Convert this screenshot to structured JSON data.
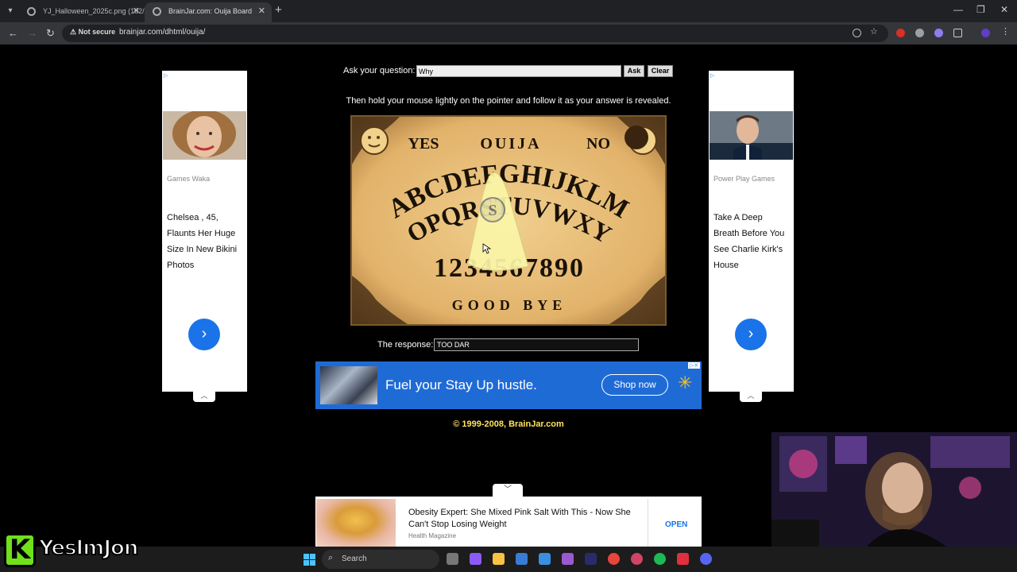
{
  "browser": {
    "tabs": [
      {
        "title": "YJ_Halloween_2025c.png (102/",
        "active": false
      },
      {
        "title": "BrainJar.com: Ouija Board",
        "active": true
      }
    ],
    "security_label": "Not secure",
    "url": "brainjar.com/dhtml/ouija/"
  },
  "question": {
    "label": "Ask your question:",
    "value": "Why",
    "ask_label": "Ask",
    "clear_label": "Clear"
  },
  "instructions": "Then hold your mouse lightly on the pointer and follow it as your answer is revealed.",
  "board": {
    "yes": "YES",
    "title": "OUIJA",
    "no": "NO",
    "row1": "ABCDEFGHIJKLM",
    "row2": "NOPQRSTUVWXYZ",
    "numbers": "1234567890",
    "goodbye": "GOOD BYE",
    "planchette_letter": "S"
  },
  "response": {
    "label": "The response:",
    "value": "TOO DAR"
  },
  "ads": {
    "left": {
      "source": "Games Waka",
      "headline": "Chelsea , 45, Flaunts Her Huge Size In New Bikini Photos"
    },
    "right": {
      "source": "Power Play Games",
      "headline": "Take A Deep Breath Before You See Charlie Kirk's House"
    },
    "banner": {
      "text": "Fuel your Stay Up hustle.",
      "cta": "Shop now"
    },
    "bottom": {
      "title": "Obesity Expert: She Mixed Pink Salt With This - Now She Can't Stop Losing Weight",
      "source": "Health Magazine",
      "cta": "OPEN"
    }
  },
  "copyright": "© 1999-2008, BrainJar.com",
  "taskbar": {
    "search_placeholder": "Search"
  },
  "overlay": {
    "badge": "K",
    "name": "YesImJon"
  },
  "colors": {
    "board_bg": "#e5bb73",
    "copyright": "#ffe45c",
    "banner": "#1f6bd6",
    "accent_blue": "#1a73e8"
  }
}
